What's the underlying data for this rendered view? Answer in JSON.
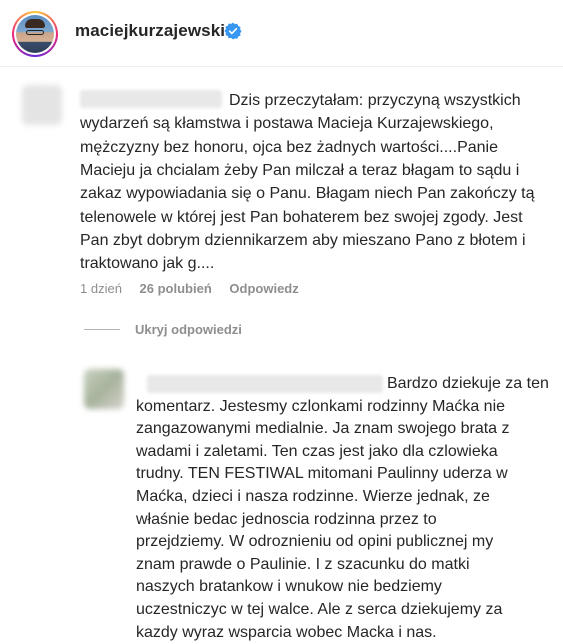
{
  "header": {
    "username": "maciejkurzajewski",
    "verified": true
  },
  "comment": {
    "lines": [
      "Dzis przeczytałam: przyczyną wszystkich",
      "wydarzeń są kłamstwa i postawa Macieja Kurzajewskiego,",
      "mężczyzny bez honoru, ojca bez żadnych wartości....Panie",
      "Macieju ja chcialam żeby Pan milczał a teraz błagam to sądu i",
      "zakaz wypowiadania się o Panu. Błagam niech Pan zakończy tą",
      "telenowele w której jest Pan bohaterem bez swojej zgody. Jest",
      "Pan zbyt dobrym dziennikarzem aby mieszano Pano z błotem i",
      "traktowano jak g...."
    ],
    "time": "1 dzień",
    "likes": "26 polubień",
    "reply_label": "Odpowiedz"
  },
  "hide_replies_label": "Ukryj odpowiedzi",
  "reply": {
    "lines": [
      "Bardzo dziekuje za ten",
      "komentarz. Jestesmy czlonkami rodzinny Maćka nie",
      "zangazowanymi medialnie. Ja znam swojego brata z",
      "wadami i zaletami. Ten czas jest jako dla czlowieka",
      "trudny. TEN FESTIWAL mitomani Paulinny uderza w",
      "Maćka, dzieci i nasza rodzinne. Wierze jednak, ze",
      "właśnie bedac jednoscia rodzinna przez to",
      "przejdziemy. W odroznieniu od opini publicznej my",
      "znam prawde o Paulinie. I z szacunku do matki",
      "naszych bratankow i wnukow nie bedziemy",
      "uczestniczyc w tej walce. Ale z serca dziekujemy za",
      "kazdy wyraz wsparcia wobec Macka i nas."
    ]
  },
  "colors": {
    "text": "#262626",
    "muted": "#8e8e8e",
    "verified_badge": "#3897f0",
    "border": "#efefef"
  },
  "icons": {
    "verified": "verified-badge-icon"
  }
}
